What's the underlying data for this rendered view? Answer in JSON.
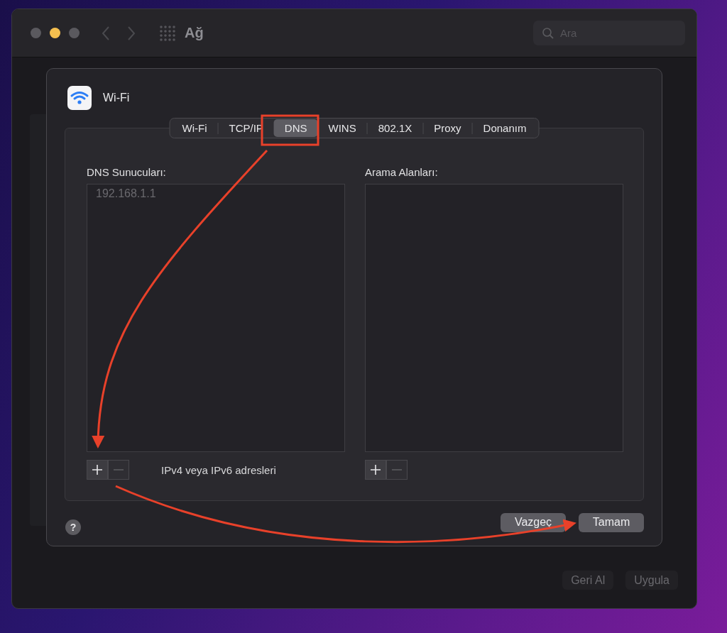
{
  "window": {
    "title": "Ağ",
    "search": {
      "placeholder": "Ara"
    }
  },
  "sheet": {
    "title": "Wi-Fi",
    "tabs": [
      {
        "label": "Wi-Fi",
        "selected": false
      },
      {
        "label": "TCP/IP",
        "selected": false
      },
      {
        "label": "DNS",
        "selected": true
      },
      {
        "label": "WINS",
        "selected": false
      },
      {
        "label": "802.1X",
        "selected": false
      },
      {
        "label": "Proxy",
        "selected": false
      },
      {
        "label": "Donanım",
        "selected": false
      }
    ],
    "dns_servers": {
      "label": "DNS Sunucuları:",
      "entries": [
        "192.168.1.1"
      ],
      "remove_disabled": true,
      "hint": "IPv4 veya IPv6 adresleri"
    },
    "search_domains": {
      "label": "Arama Alanları:",
      "remove_disabled": true
    },
    "help": "?",
    "buttons": [
      {
        "label": "Vazgeç"
      },
      {
        "label": "Tamam"
      }
    ]
  },
  "footer_buttons": [
    {
      "label": "Geri Al",
      "disabled": true
    },
    {
      "label": "Uygula",
      "disabled": true
    }
  ]
}
